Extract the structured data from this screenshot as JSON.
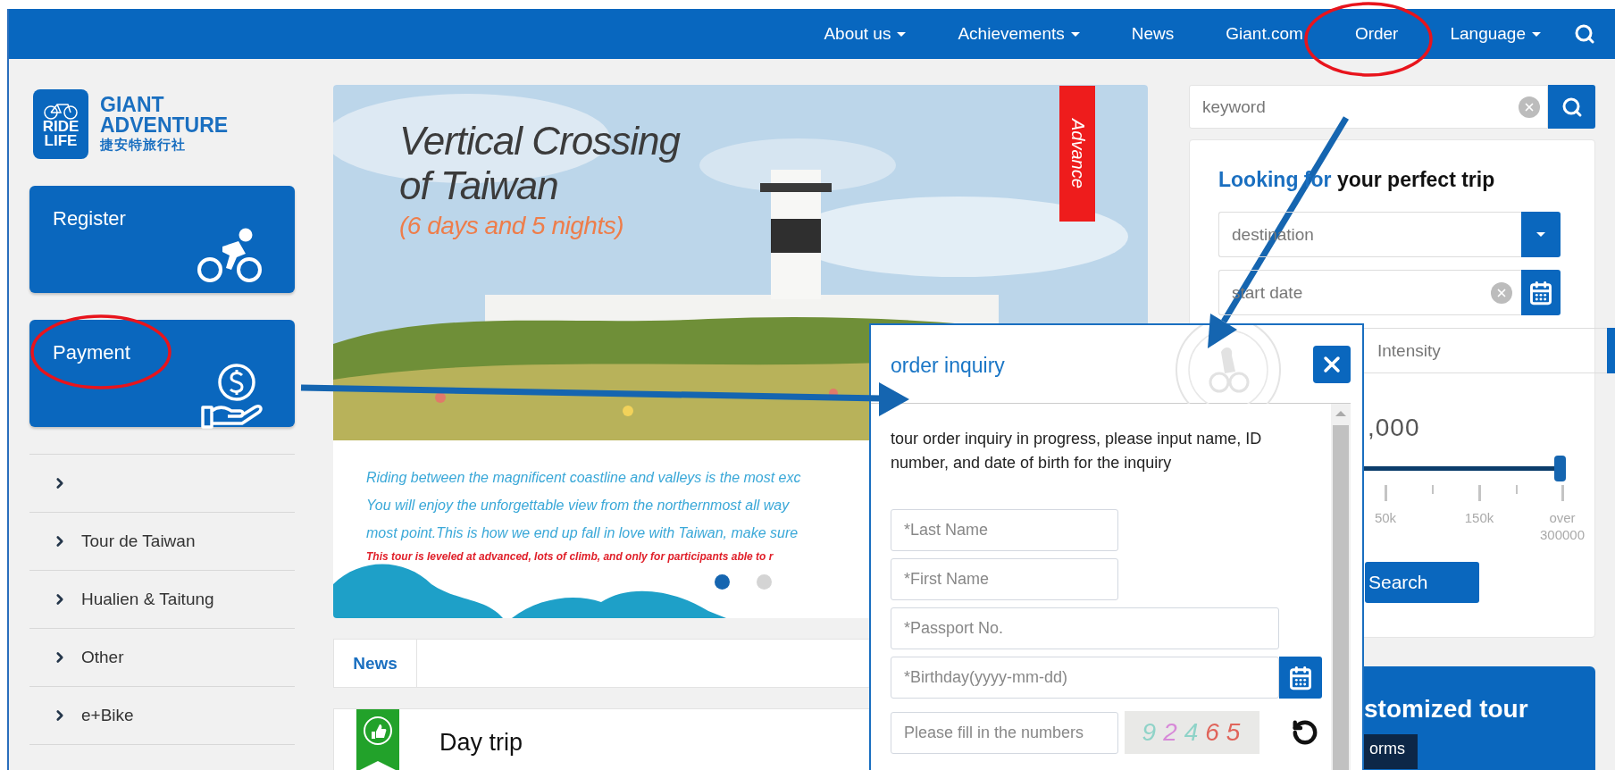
{
  "nav": {
    "items": [
      {
        "label": "About us",
        "has_menu": true
      },
      {
        "label": "Achievements",
        "has_menu": true
      },
      {
        "label": "News",
        "has_menu": false
      },
      {
        "label": "Giant.com",
        "has_menu": false
      },
      {
        "label": "Order",
        "has_menu": false
      },
      {
        "label": "Language",
        "has_menu": true
      }
    ]
  },
  "logo": {
    "badge_lines": [
      "RIDE",
      "LIFE"
    ],
    "name_lines": [
      "GIANT",
      "ADVENTURE"
    ],
    "name_zh": "捷安特旅行社"
  },
  "action_cards": [
    {
      "label": "Register",
      "kind": "cycling"
    },
    {
      "label": "Payment",
      "kind": "payment"
    }
  ],
  "sidebar": {
    "items": [
      {
        "label": "Tour de Taiwan"
      },
      {
        "label": "Hualien & Taitung"
      },
      {
        "label": "Other"
      },
      {
        "label": "e+Bike"
      }
    ]
  },
  "banner": {
    "title_lines": [
      "Vertical Crossing",
      "of Taiwan"
    ],
    "subtitle": "(6 days and 5 nights)",
    "ribbon": "Advance",
    "description_lines": [
      "Riding between the magnificent coastline and valleys is the most exc",
      "You will enjoy the unforgettable view from the northernmost all way",
      "most point.This is how we end up fall in love with Taiwan, make sure"
    ],
    "warning": "This tour is leveled at advanced, lots of climb, and only for participants able to r",
    "slides": [
      {
        "selected": true
      },
      {
        "selected": false
      }
    ]
  },
  "news_bar": {
    "tabs": [
      {
        "label": "News",
        "selected": true
      }
    ]
  },
  "featured": {
    "title": "Day trip"
  },
  "search": {
    "placeholder": "keyword"
  },
  "trip_finder": {
    "heading_accent": "Looking for",
    "heading_rest": "your perfect trip",
    "destination": {
      "placeholder": "destination"
    },
    "start_date": {
      "placeholder": "start date"
    },
    "intensity": {
      "placeholder": "Intensity"
    },
    "price": ",000",
    "slider": {
      "level": 1,
      "labels": [
        "50k",
        "150k",
        "over 300000"
      ]
    },
    "search_button": "Search"
  },
  "custom_tour": {
    "title": "stomized tour",
    "button": "orms"
  },
  "modal": {
    "title": "order inquiry",
    "message": "tour order inquiry in progress, please input name, ID number, and date of birth for the inquiry",
    "fields": [
      {
        "kind": "short",
        "placeholder": "*Last Name"
      },
      {
        "kind": "short",
        "placeholder": "*First Name"
      },
      {
        "kind": "long",
        "placeholder": "*Passport No."
      },
      {
        "kind": "date",
        "placeholder": "*Birthday(yyyy-mm-dd)"
      },
      {
        "kind": "captcha",
        "placeholder": "Please fill in the numbers",
        "code": "92465"
      }
    ]
  }
}
